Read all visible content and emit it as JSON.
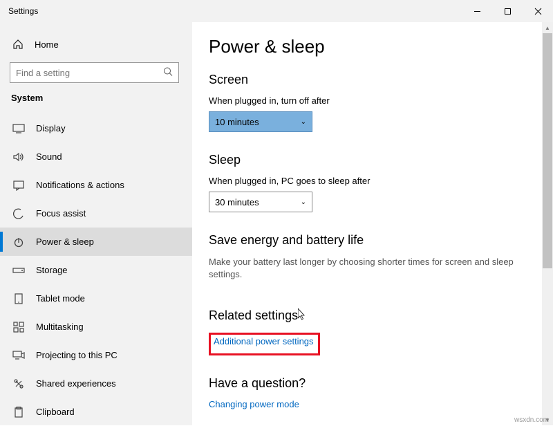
{
  "window": {
    "title": "Settings"
  },
  "sidebar": {
    "home": "Home",
    "search_placeholder": "Find a setting",
    "section": "System",
    "items": [
      {
        "label": "Display"
      },
      {
        "label": "Sound"
      },
      {
        "label": "Notifications & actions"
      },
      {
        "label": "Focus assist"
      },
      {
        "label": "Power & sleep"
      },
      {
        "label": "Storage"
      },
      {
        "label": "Tablet mode"
      },
      {
        "label": "Multitasking"
      },
      {
        "label": "Projecting to this PC"
      },
      {
        "label": "Shared experiences"
      },
      {
        "label": "Clipboard"
      }
    ]
  },
  "main": {
    "title": "Power & sleep",
    "screen": {
      "heading": "Screen",
      "label": "When plugged in, turn off after",
      "value": "10 minutes"
    },
    "sleep": {
      "heading": "Sleep",
      "label": "When plugged in, PC goes to sleep after",
      "value": "30 minutes"
    },
    "save": {
      "heading": "Save energy and battery life",
      "body": "Make your battery last longer by choosing shorter times for screen and sleep settings."
    },
    "related": {
      "heading": "Related settings",
      "link": "Additional power settings"
    },
    "question": {
      "heading": "Have a question?",
      "link": "Changing power mode"
    }
  },
  "watermark": "wsxdn.com"
}
